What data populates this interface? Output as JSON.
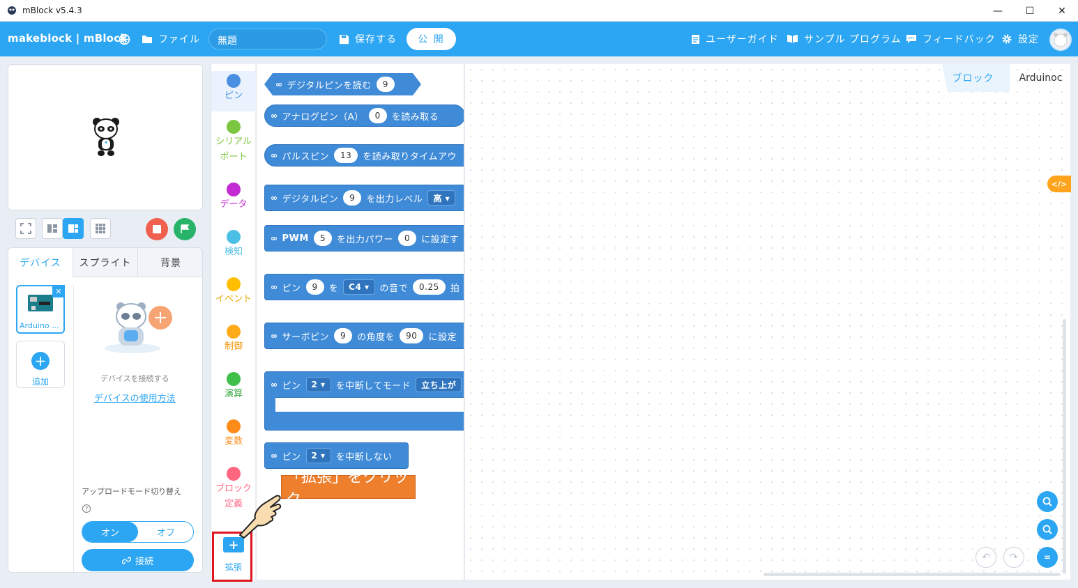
{
  "window": {
    "title": "mBlock v5.4.3",
    "minimize": "—",
    "maximize": "☐",
    "close": "✕"
  },
  "menubar": {
    "logo": "makeblock | mBlock",
    "file": "ファイル",
    "project_title": "無題",
    "save": "保存する",
    "publish": "公 開",
    "user_guide": "ユーザーガイド",
    "sample_programs": "サンプル プログラム",
    "feedback": "フィードバック",
    "settings": "設定"
  },
  "device_panel": {
    "tabs": [
      "デバイス",
      "スプライト",
      "背景"
    ],
    "device_name": "Arduino ...",
    "add_label": "追加",
    "connect_prompt": "デバイスを接続する",
    "usage_link": "デバイスの使用方法",
    "upload_mode_label": "アップロードモード切り替え",
    "help_icon": "?",
    "toggle_on": "オン",
    "toggle_off": "オフ",
    "connect_button": "接続"
  },
  "categories": [
    {
      "label": "ピン",
      "color": "#4a90e2"
    },
    {
      "label": "シリアル\nポート",
      "color": "#7bc640"
    },
    {
      "label": "データ",
      "color": "#c22bd4"
    },
    {
      "label": "検知",
      "color": "#4cbfe6"
    },
    {
      "label": "イベント",
      "color": "#ffbf00"
    },
    {
      "label": "制御",
      "color": "#ffab19"
    },
    {
      "label": "演算",
      "color": "#40bf4a"
    },
    {
      "label": "変数",
      "color": "#ff8c1a"
    },
    {
      "label": "ブロック\n定義",
      "color": "#ff6680"
    }
  ],
  "extension_button": {
    "label": "拡張",
    "icon": "+"
  },
  "blocks": {
    "b1": {
      "t1": "デジタルピンを読む",
      "v1": "9"
    },
    "b2": {
      "t1": "アナログピン（A）",
      "v1": "0",
      "t2": "を読み取る"
    },
    "b3": {
      "t1": "パルスピン",
      "v1": "13",
      "t2": "を読み取りタイムアウ"
    },
    "b4": {
      "t1": "デジタルピン",
      "v1": "9",
      "t2": "を出力レベル",
      "d1": "高 ▾"
    },
    "b5": {
      "t1": "PWM",
      "v1": "5",
      "t2": "を出力パワー",
      "v2": "0",
      "t3": "に設定す"
    },
    "b6": {
      "t1": "ピン",
      "v1": "9",
      "t2": "を",
      "d1": "C4 ▾",
      "t3": "の音で",
      "v2": "0.25",
      "t4": "拍"
    },
    "b7": {
      "t1": "サーボピン",
      "v1": "9",
      "t2": "の角度を",
      "v2": "90",
      "t3": "に設定"
    },
    "b8": {
      "t1": "ピン",
      "d1": "2 ▾",
      "t2": "を中断してモード",
      "d2": "立ち上が"
    },
    "b9": {
      "t1": "ピン",
      "d1": "2 ▾",
      "t2": "を中断しない"
    }
  },
  "canvas": {
    "tab_blocks": "ブロック",
    "tab_arduino": "Arduinoc",
    "code_toggle": "</>",
    "zoom_in": "+",
    "zoom_out": "−",
    "zoom_reset": "="
  },
  "annotation": {
    "callout": "「拡張」をクリック"
  },
  "icons": {
    "globe": "globe-icon",
    "folder": "folder-icon",
    "save": "save-icon",
    "guide": "document-icon",
    "samples": "book-icon",
    "feedback": "chat-icon",
    "settings": "gear-icon",
    "link": "link-icon"
  }
}
